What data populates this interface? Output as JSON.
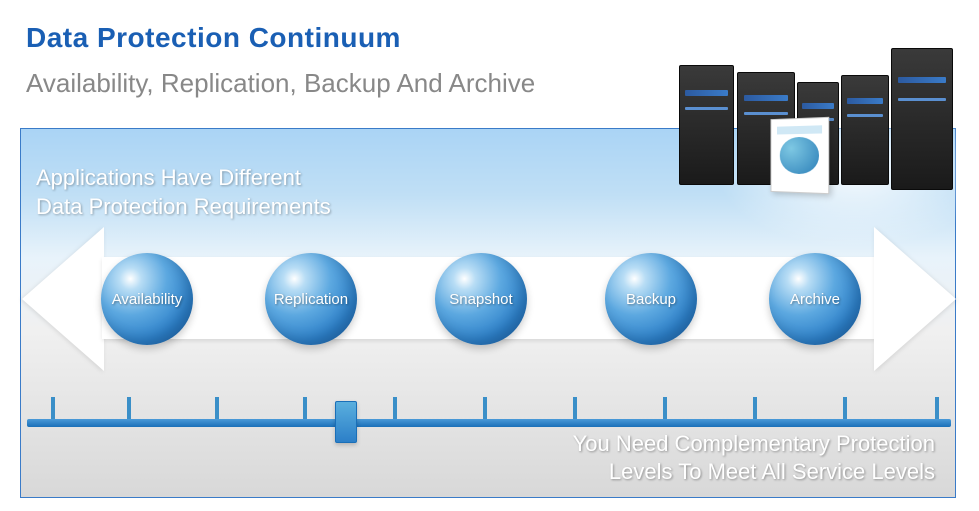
{
  "title": "Data Protection Continuum",
  "subtitle": "Availability, Replication, Backup And Archive",
  "panel": {
    "top_text_line1": "Applications Have Different",
    "top_text_line2": "Data Protection Requirements",
    "bottom_text_line1": "You Need Complementary Protection",
    "bottom_text_line2": "Levels To Meet All Service Levels"
  },
  "continuum": {
    "items": [
      {
        "label": "Availability"
      },
      {
        "label": "Replication"
      },
      {
        "label": "Snapshot"
      },
      {
        "label": "Backup"
      },
      {
        "label": "Archive"
      }
    ]
  },
  "colors": {
    "primary_blue": "#1a5fb4",
    "sphere_blue": "#2c7fc8",
    "timeline_blue": "#3a8fc8"
  }
}
